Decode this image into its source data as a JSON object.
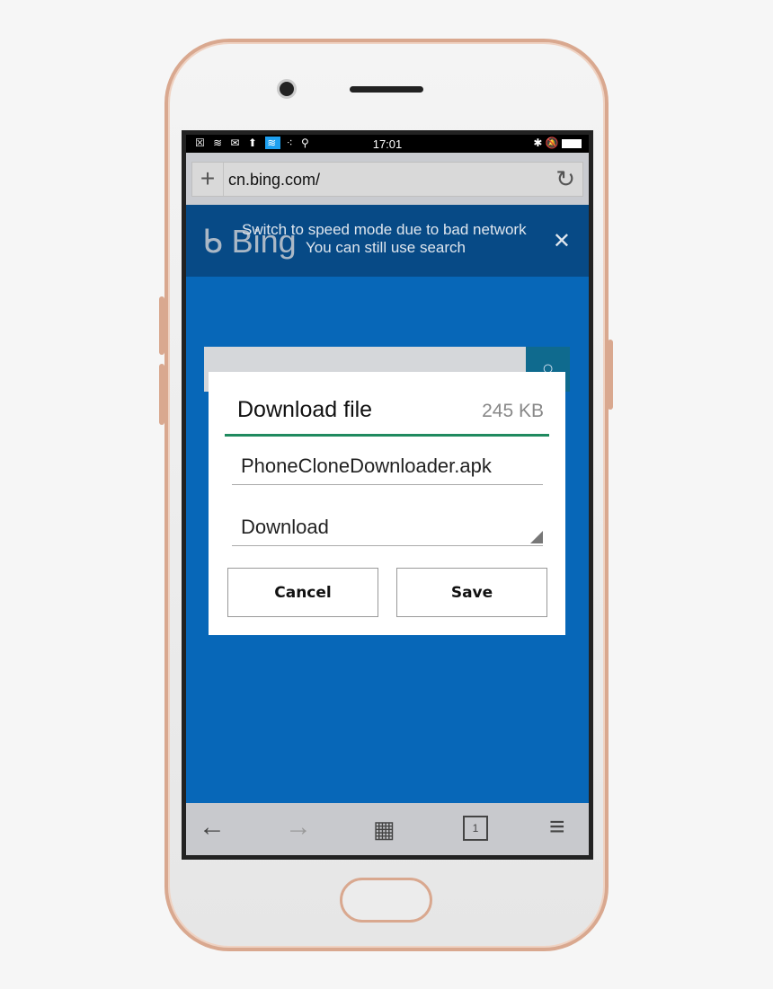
{
  "status": {
    "time": "17:01",
    "left_icons": [
      "notification-icon",
      "wifi-icon",
      "mail-icon",
      "upload-icon",
      "hotspot-icon",
      "dots-icon",
      "keyhole-icon"
    ],
    "right_icons": [
      "bluetooth-icon",
      "mute-icon",
      "battery-icon"
    ]
  },
  "browser": {
    "url": "cn.bing.com/"
  },
  "banner": {
    "logo": "Bing",
    "line1": "Switch to speed mode due to bad network",
    "line2": "You can still use search"
  },
  "dialog": {
    "title": "Download file",
    "size": "245 KB",
    "filename": "PhoneCloneDownloader.apk",
    "folder": "Download",
    "cancel": "Cancel",
    "save": "Save",
    "accent": "#1f8a5f"
  },
  "nav": {
    "tabs_count": "1"
  },
  "colors": {
    "banner": "#074a86",
    "page": "#0767b8"
  }
}
